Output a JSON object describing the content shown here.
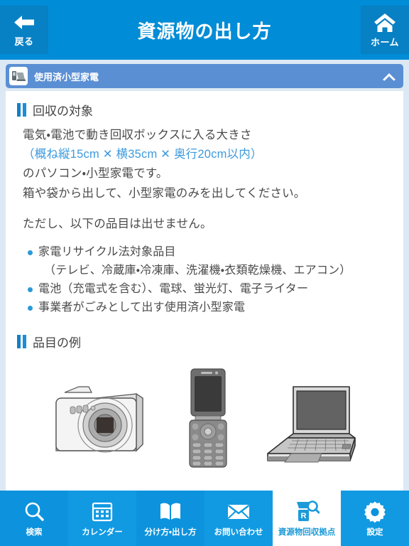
{
  "header": {
    "title": "資源物の出し方",
    "back": {
      "label": "戻る",
      "icon": "arrow-left-icon"
    },
    "home": {
      "label": "ホーム",
      "icon": "home-icon"
    }
  },
  "accordion": {
    "title": "使用済小型家電",
    "icon": "phone-laptop-icon",
    "chevron": "chevron-up-icon",
    "expanded": true
  },
  "sections": [
    {
      "heading": "回収の対象",
      "lines": [
        {
          "text": "電気・電池で動き回収ボックスに入る大きさ",
          "highlight": false
        },
        {
          "text": "（概ね縦15cm ✕ 横35cm ✕ 奥行20cm以内）",
          "highlight": true
        },
        {
          "text": "のパソコン・小型家電です。",
          "highlight": false
        },
        {
          "text": "箱や袋から出して、小型家電のみを出してください。",
          "highlight": false
        }
      ],
      "note": "ただし、以下の品目は出せません。",
      "items": [
        {
          "text": "家電リサイクル法対象品目",
          "sub": "（テレビ、冷蔵庫・冷凍庫、洗濯機・衣類乾燥機、エアコン）"
        },
        {
          "text": "電池（充電式を含む）、電球、蛍光灯、電子ライター",
          "sub": ""
        },
        {
          "text": "事業者がごみとして出す使用済小型家電",
          "sub": ""
        }
      ]
    },
    {
      "heading": "品目の例",
      "gallery": [
        {
          "name": "digital-camera-illustration"
        },
        {
          "name": "flip-phone-illustration"
        },
        {
          "name": "laptop-illustration"
        }
      ]
    }
  ],
  "tabbar": {
    "tabs": [
      {
        "label": "検索",
        "icon": "search-icon",
        "active": false
      },
      {
        "label": "カレンダー",
        "icon": "calendar-icon",
        "active": false
      },
      {
        "label": "分け方・出し方",
        "icon": "book-icon",
        "active": false
      },
      {
        "label": "お問い合わせ",
        "icon": "mail-icon",
        "active": false
      },
      {
        "label": "資源物回収拠点",
        "icon": "recycle-search-icon",
        "active": true
      },
      {
        "label": "設定",
        "icon": "gear-icon",
        "active": false
      }
    ]
  },
  "colors": {
    "header_blue": "#008cd6",
    "header_btn_blue": "#0880c4",
    "accordion_blue": "#5b8fd4",
    "tabbar_blue": "#0d93dd",
    "accent_blue": "#3d9ade",
    "bullet_blue": "#2a9ad8",
    "page_bg": "#dce9f4",
    "text_gray": "#4a4a4a"
  }
}
